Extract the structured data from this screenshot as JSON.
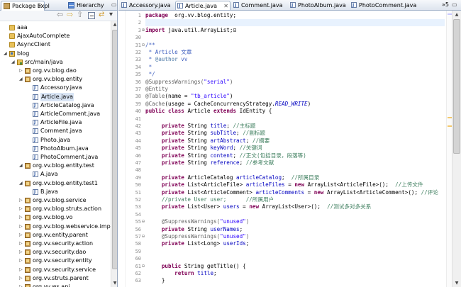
{
  "left_panel": {
    "tabs": [
      {
        "label": "Package Expl",
        "icon": "package-explorer-icon",
        "active": true
      },
      {
        "label": "Hierarchy",
        "icon": "hierarchy-icon",
        "active": false
      }
    ],
    "close_glyph": "✕",
    "minmax_glyph": "▭",
    "toolbar_icons": [
      "back-icon",
      "forward-icon",
      "up-icon",
      "collapse-all-icon",
      "link-with-editor-icon",
      "view-menu-icon"
    ],
    "tree": [
      {
        "label": "aaa",
        "type": "folder",
        "depth": 0,
        "expanded": null,
        "selected": false
      },
      {
        "label": "AjaxAutoComplete",
        "type": "folder",
        "depth": 0,
        "expanded": null,
        "selected": false
      },
      {
        "label": "AsyncClient",
        "type": "folder",
        "depth": 0,
        "expanded": null,
        "selected": false
      },
      {
        "label": "blog",
        "type": "project",
        "depth": 0,
        "expanded": true,
        "selected": false
      },
      {
        "label": "src/main/java",
        "type": "source-folder",
        "depth": 1,
        "expanded": true,
        "selected": false
      },
      {
        "label": "org.vv.blog.dao",
        "type": "package",
        "depth": 2,
        "expanded": false,
        "selected": false
      },
      {
        "label": "org.vv.blog.entity",
        "type": "package",
        "depth": 2,
        "expanded": true,
        "selected": false
      },
      {
        "label": "Accessory.java",
        "type": "java-file",
        "depth": 3,
        "expanded": null,
        "selected": false
      },
      {
        "label": "Article.java",
        "type": "java-file",
        "depth": 3,
        "expanded": null,
        "selected": true
      },
      {
        "label": "ArticleCatalog.java",
        "type": "java-file",
        "depth": 3,
        "expanded": null,
        "selected": false
      },
      {
        "label": "ArticleComment.java",
        "type": "java-file",
        "depth": 3,
        "expanded": null,
        "selected": false
      },
      {
        "label": "ArticleFile.java",
        "type": "java-file",
        "depth": 3,
        "expanded": null,
        "selected": false
      },
      {
        "label": "Comment.java",
        "type": "java-file",
        "depth": 3,
        "expanded": null,
        "selected": false
      },
      {
        "label": "Photo.java",
        "type": "java-file",
        "depth": 3,
        "expanded": null,
        "selected": false
      },
      {
        "label": "PhotoAlbum.java",
        "type": "java-file",
        "depth": 3,
        "expanded": null,
        "selected": false
      },
      {
        "label": "PhotoComment.java",
        "type": "java-file",
        "depth": 3,
        "expanded": null,
        "selected": false
      },
      {
        "label": "org.vv.blog.entity.test",
        "type": "package",
        "depth": 2,
        "expanded": true,
        "selected": false
      },
      {
        "label": "A.java",
        "type": "java-file",
        "depth": 3,
        "expanded": null,
        "selected": false
      },
      {
        "label": "org.vv.blog.entity.test1",
        "type": "package",
        "depth": 2,
        "expanded": true,
        "selected": false
      },
      {
        "label": "B.java",
        "type": "java-file",
        "depth": 3,
        "expanded": null,
        "selected": false
      },
      {
        "label": "org.vv.blog.service",
        "type": "package",
        "depth": 2,
        "expanded": false,
        "selected": false
      },
      {
        "label": "org.vv.blog.struts.action",
        "type": "package",
        "depth": 2,
        "expanded": false,
        "selected": false
      },
      {
        "label": "org.vv.blog.vo",
        "type": "package",
        "depth": 2,
        "expanded": false,
        "selected": false
      },
      {
        "label": "org.vv.blog.webservice.impl",
        "type": "package",
        "depth": 2,
        "expanded": false,
        "selected": false
      },
      {
        "label": "org.vv.entity.parent",
        "type": "package",
        "depth": 2,
        "expanded": false,
        "selected": false
      },
      {
        "label": "org.vv.security.action",
        "type": "package",
        "depth": 2,
        "expanded": false,
        "selected": false
      },
      {
        "label": "org.vv.security.dao",
        "type": "package",
        "depth": 2,
        "expanded": false,
        "selected": false
      },
      {
        "label": "org.vv.security.entity",
        "type": "package",
        "depth": 2,
        "expanded": false,
        "selected": false
      },
      {
        "label": "org.vv.security.service",
        "type": "package",
        "depth": 2,
        "expanded": false,
        "selected": false
      },
      {
        "label": "org.vv.struts.parent",
        "type": "package",
        "depth": 2,
        "expanded": false,
        "selected": false
      },
      {
        "label": "org.vv.ws.api",
        "type": "package",
        "depth": 2,
        "expanded": false,
        "selected": false
      }
    ]
  },
  "editor": {
    "tabs": [
      {
        "label": "Accessory.java",
        "active": false
      },
      {
        "label": "Article.java",
        "active": true
      },
      {
        "label": "Comment.java",
        "active": false
      },
      {
        "label": "PhotoAlbum.java",
        "active": false
      },
      {
        "label": "PhotoComment.java",
        "active": false
      }
    ],
    "close_glyph": "✕",
    "overflow_label": "»5",
    "minmax_glyph": "▭",
    "lines": [
      {
        "num": "1",
        "fold": "",
        "segs": [
          [
            "kw",
            "package"
          ],
          [
            "",
            "  org.vv.blog.entity;"
          ]
        ]
      },
      {
        "num": "2",
        "fold": "",
        "segs": []
      },
      {
        "num": "3",
        "fold": "⊕",
        "segs": [
          [
            "kw",
            "import"
          ],
          [
            "",
            " java.util.ArrayList;"
          ],
          [
            "",
            "⊡"
          ]
        ]
      },
      {
        "num": "30",
        "fold": "",
        "segs": []
      },
      {
        "num": "31",
        "fold": "⊖",
        "segs": [
          [
            "jd",
            "/**"
          ]
        ]
      },
      {
        "num": "32",
        "fold": "",
        "segs": [
          [
            "jd",
            " * Article 文章"
          ]
        ]
      },
      {
        "num": "33",
        "fold": "",
        "segs": [
          [
            "jd",
            " * "
          ],
          [
            "jtag",
            "@author"
          ],
          [
            "jd",
            " vv"
          ]
        ]
      },
      {
        "num": "34",
        "fold": "",
        "segs": [
          [
            "jd",
            " *"
          ]
        ]
      },
      {
        "num": "35",
        "fold": "",
        "segs": [
          [
            "jd",
            " */"
          ]
        ]
      },
      {
        "num": "36",
        "fold": "",
        "segs": [
          [
            "anno",
            "@SuppressWarnings("
          ],
          [
            "str",
            "\"serial\""
          ],
          [
            "anno",
            ")"
          ]
        ]
      },
      {
        "num": "37",
        "fold": "",
        "segs": [
          [
            "anno",
            "@Entity"
          ]
        ]
      },
      {
        "num": "38",
        "fold": "",
        "segs": [
          [
            "anno",
            "@Table"
          ],
          [
            "",
            "(name = "
          ],
          [
            "str",
            "\"tb_article\""
          ],
          [
            "",
            ")"
          ]
        ]
      },
      {
        "num": "39",
        "fold": "",
        "segs": [
          [
            "anno",
            "@Cache"
          ],
          [
            "",
            "(usage = CacheConcurrencyStrategy."
          ],
          [
            "sfld",
            "READ_WRITE"
          ],
          [
            "",
            ")"
          ]
        ]
      },
      {
        "num": "40",
        "fold": "",
        "segs": [
          [
            "kw",
            "public class"
          ],
          [
            "",
            " Article "
          ],
          [
            "kw",
            "extends"
          ],
          [
            "",
            " IdEntity {"
          ]
        ]
      },
      {
        "num": "41",
        "fold": "",
        "segs": []
      },
      {
        "num": "42",
        "fold": "",
        "segs": [
          [
            "",
            "     "
          ],
          [
            "kw",
            "private"
          ],
          [
            "",
            " String "
          ],
          [
            "fld",
            "title"
          ],
          [
            "",
            "; "
          ],
          [
            "cmt",
            "//主标题"
          ]
        ]
      },
      {
        "num": "43",
        "fold": "",
        "segs": [
          [
            "",
            "     "
          ],
          [
            "kw",
            "private"
          ],
          [
            "",
            " String "
          ],
          [
            "fld",
            "subTitle"
          ],
          [
            "",
            "; "
          ],
          [
            "cmt",
            "//副标题"
          ]
        ]
      },
      {
        "num": "44",
        "fold": "",
        "segs": [
          [
            "",
            "     "
          ],
          [
            "kw",
            "private"
          ],
          [
            "",
            " String "
          ],
          [
            "fld",
            "artAbstract"
          ],
          [
            "",
            "; "
          ],
          [
            "cmt",
            "//摘要"
          ]
        ]
      },
      {
        "num": "45",
        "fold": "",
        "segs": [
          [
            "",
            "     "
          ],
          [
            "kw",
            "private"
          ],
          [
            "",
            " String "
          ],
          [
            "fld",
            "keyWord"
          ],
          [
            "",
            "; "
          ],
          [
            "cmt",
            "//关键词"
          ]
        ]
      },
      {
        "num": "46",
        "fold": "",
        "segs": [
          [
            "",
            "     "
          ],
          [
            "kw",
            "private"
          ],
          [
            "",
            " String "
          ],
          [
            "fld",
            "content"
          ],
          [
            "",
            "; "
          ],
          [
            "cmt",
            "//正文(包括目录，段落等)"
          ]
        ]
      },
      {
        "num": "47",
        "fold": "",
        "segs": [
          [
            "",
            "     "
          ],
          [
            "kw",
            "private"
          ],
          [
            "",
            " String "
          ],
          [
            "fld",
            "reference"
          ],
          [
            "",
            "; "
          ],
          [
            "cmt",
            "//参考文献"
          ]
        ]
      },
      {
        "num": "48",
        "fold": "",
        "segs": []
      },
      {
        "num": "49",
        "fold": "",
        "segs": [
          [
            "",
            "     "
          ],
          [
            "kw",
            "private"
          ],
          [
            "",
            " ArticleCatalog "
          ],
          [
            "fld",
            "articleCatalog"
          ],
          [
            "",
            ";  "
          ],
          [
            "cmt",
            "//所属目录"
          ]
        ]
      },
      {
        "num": "50",
        "fold": "",
        "segs": [
          [
            "",
            "     "
          ],
          [
            "kw",
            "private"
          ],
          [
            "",
            " List<ArticleFile> "
          ],
          [
            "fld",
            "articleFiles"
          ],
          [
            "",
            " = "
          ],
          [
            "kw",
            "new"
          ],
          [
            "",
            " ArrayList<ArticleFile>();  "
          ],
          [
            "cmt",
            "//上传文件"
          ]
        ]
      },
      {
        "num": "51",
        "fold": "",
        "segs": [
          [
            "",
            "     "
          ],
          [
            "kw",
            "private"
          ],
          [
            "",
            " List<ArticleComment> "
          ],
          [
            "fld",
            "articleComments"
          ],
          [
            "",
            " = "
          ],
          [
            "kw",
            "new"
          ],
          [
            "",
            " ArrayList<ArticleComment>(); "
          ],
          [
            "cmt",
            "//评论"
          ]
        ]
      },
      {
        "num": "52",
        "fold": "",
        "segs": [
          [
            "",
            "     "
          ],
          [
            "cmt",
            "//private User user;      //所属用户"
          ]
        ]
      },
      {
        "num": "53",
        "fold": "",
        "segs": [
          [
            "",
            "     "
          ],
          [
            "kw",
            "private"
          ],
          [
            "",
            " List<User> "
          ],
          [
            "fld",
            "users"
          ],
          [
            "",
            " = "
          ],
          [
            "kw",
            "new"
          ],
          [
            "",
            " ArrayList<User>();  "
          ],
          [
            "cmt",
            "//测试多对多关系"
          ]
        ]
      },
      {
        "num": "54",
        "fold": "",
        "segs": []
      },
      {
        "num": "55",
        "fold": "⊖",
        "segs": [
          [
            "",
            "     "
          ],
          [
            "anno",
            "@SuppressWarnings("
          ],
          [
            "str",
            "\"unused\""
          ],
          [
            "anno",
            ")"
          ]
        ]
      },
      {
        "num": "56",
        "fold": "",
        "segs": [
          [
            "",
            "     "
          ],
          [
            "kw",
            "private"
          ],
          [
            "",
            " String "
          ],
          [
            "fld",
            "userNames"
          ],
          [
            ";",
            ";"
          ]
        ]
      },
      {
        "num": "57",
        "fold": "⊖",
        "segs": [
          [
            "",
            "     "
          ],
          [
            "anno",
            "@SuppressWarnings("
          ],
          [
            "str",
            "\"unused\""
          ],
          [
            "anno",
            ")"
          ]
        ]
      },
      {
        "num": "58",
        "fold": "",
        "segs": [
          [
            "",
            "     "
          ],
          [
            "kw",
            "private"
          ],
          [
            "",
            " List<Long> "
          ],
          [
            "fld",
            "userIds"
          ],
          [
            "",
            ";"
          ]
        ]
      },
      {
        "num": "59",
        "fold": "",
        "segs": []
      },
      {
        "num": "60",
        "fold": "",
        "segs": []
      },
      {
        "num": "61",
        "fold": "⊖",
        "segs": [
          [
            "",
            "     "
          ],
          [
            "kw",
            "public"
          ],
          [
            "",
            " String getTitle() {"
          ]
        ]
      },
      {
        "num": "62",
        "fold": "",
        "segs": [
          [
            "",
            "         "
          ],
          [
            "kw",
            "return"
          ],
          [
            "",
            " "
          ],
          [
            "fld",
            "title"
          ],
          [
            "",
            ";"
          ]
        ]
      },
      {
        "num": "63",
        "fold": "",
        "segs": [
          [
            "",
            "     }"
          ]
        ]
      }
    ],
    "current_line_index": 1
  },
  "colors": {
    "keyword": "#7f0055",
    "string": "#2a00ff",
    "comment": "#3f7f5f",
    "javadoc": "#3f5fbf",
    "field": "#0000c0",
    "annotation": "#646464",
    "line_number": "#8c8c8c",
    "selection": "#d9e5f5",
    "current_line": "#e8f2fe"
  }
}
